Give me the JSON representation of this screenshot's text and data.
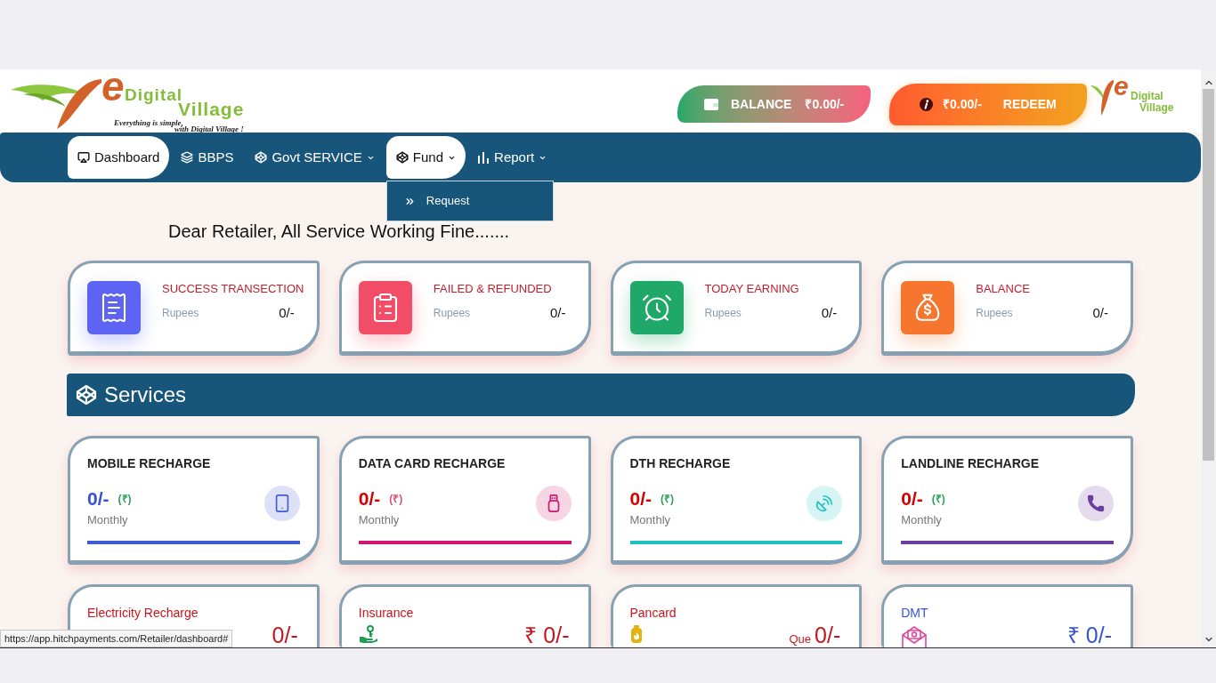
{
  "header": {
    "logo": {
      "letter": "e",
      "line1": "Digital",
      "line2": "Village",
      "tagline": [
        "Everything is simple,",
        "with Digital Village !"
      ]
    },
    "balance": {
      "label": "BALANCE",
      "amount": "₹0.00/-"
    },
    "redeem": {
      "amount": "₹0.00/-",
      "label": "REDEEM"
    },
    "logo_small": {
      "letter": "e",
      "line1": "Digital",
      "line2": "Village"
    }
  },
  "nav": [
    {
      "label": "Dashboard",
      "kind": "link",
      "selected": true,
      "expanded": false
    },
    {
      "label": "BBPS",
      "kind": "link",
      "selected": false,
      "expanded": false
    },
    {
      "label": "Govt SERVICE",
      "kind": "menu",
      "selected": false,
      "expanded": false
    },
    {
      "label": "Fund",
      "kind": "menu",
      "selected": true,
      "expanded": true,
      "menu": [
        {
          "label": "Request"
        }
      ]
    },
    {
      "label": "Report",
      "kind": "menu",
      "selected": false,
      "expanded": false
    }
  ],
  "notice": "Dear Retailer, All Service Working Fine.......",
  "stats": [
    {
      "title": "SUCCESS TRANSECTION",
      "label": "Rupees",
      "value": "0/-",
      "color": "#5d63f2"
    },
    {
      "title": "FAILED & REFUNDED",
      "label": "Rupees",
      "value": "0/-",
      "color": "#f24d66"
    },
    {
      "title": "TODAY EARNING",
      "label": "Rupees",
      "value": "0/-",
      "color": "#1fa868"
    },
    {
      "title": "BALANCE",
      "label": "Rupees",
      "value": "0/-",
      "color": "#f7762f"
    }
  ],
  "services_header": {
    "title": "Services"
  },
  "services": [
    {
      "title": "MOBILE RECHARGE",
      "value": {
        "text": "0/-",
        "color": "#3451d1"
      },
      "unit": {
        "text": "(₹)",
        "color": "#2e9e5e"
      },
      "period": "Monthly",
      "color": "#3f5bd6"
    },
    {
      "title": "DATA CARD RECHARGE",
      "value": {
        "text": "0/-",
        "color": "#d40000"
      },
      "unit": {
        "text": "(₹)",
        "color": "#d9536f"
      },
      "period": "Monthly",
      "color": "#d0166e"
    },
    {
      "title": "DTH RECHARGE",
      "value": {
        "text": "0/-",
        "color": "#d40000"
      },
      "unit": {
        "text": "(₹)",
        "color": "#2e9e5e"
      },
      "period": "Monthly",
      "color": "#20c0c0"
    },
    {
      "title": "LANDLINE RECHARGE",
      "value": {
        "text": "0/-",
        "color": "#d40000"
      },
      "unit": {
        "text": "(₹)",
        "color": "#2e9e5e"
      },
      "period": "Monthly",
      "color": "#6b3fa0"
    }
  ],
  "more_services": [
    {
      "title": "Electricity Recharge",
      "value": "0/-",
      "color": "#c8141c"
    },
    {
      "title": "Insurance",
      "value": "₹ 0/-",
      "color": "#c8141c"
    },
    {
      "title": "Pancard",
      "prefix": "Que",
      "value": "0/-",
      "color": "#c8141c"
    },
    {
      "title": "DMT",
      "value": "₹ 0/-",
      "color": "#3553d8"
    }
  ],
  "status_url": "https://app.hitchpayments.com/Retailer/dashboard#"
}
